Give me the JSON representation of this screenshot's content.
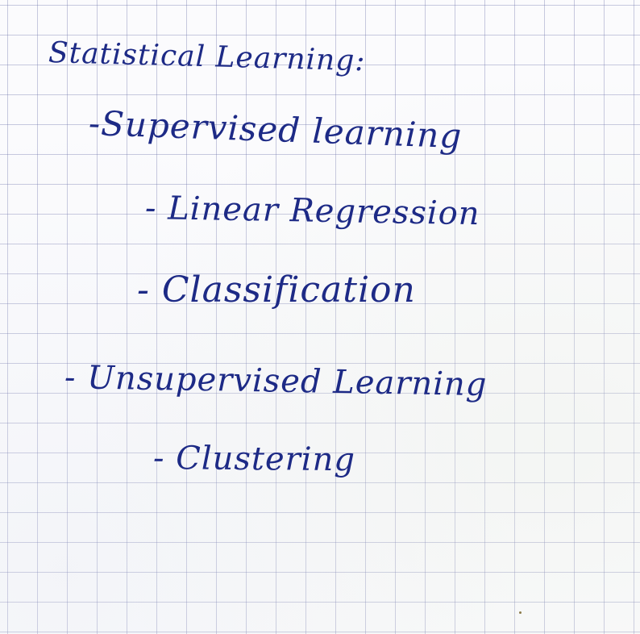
{
  "notes": {
    "title": "Statistical Learning:",
    "items": [
      "-Supervised learning",
      "- Linear Regression",
      "- Classification",
      "- Unsupervised Learning",
      "- Clustering"
    ]
  }
}
